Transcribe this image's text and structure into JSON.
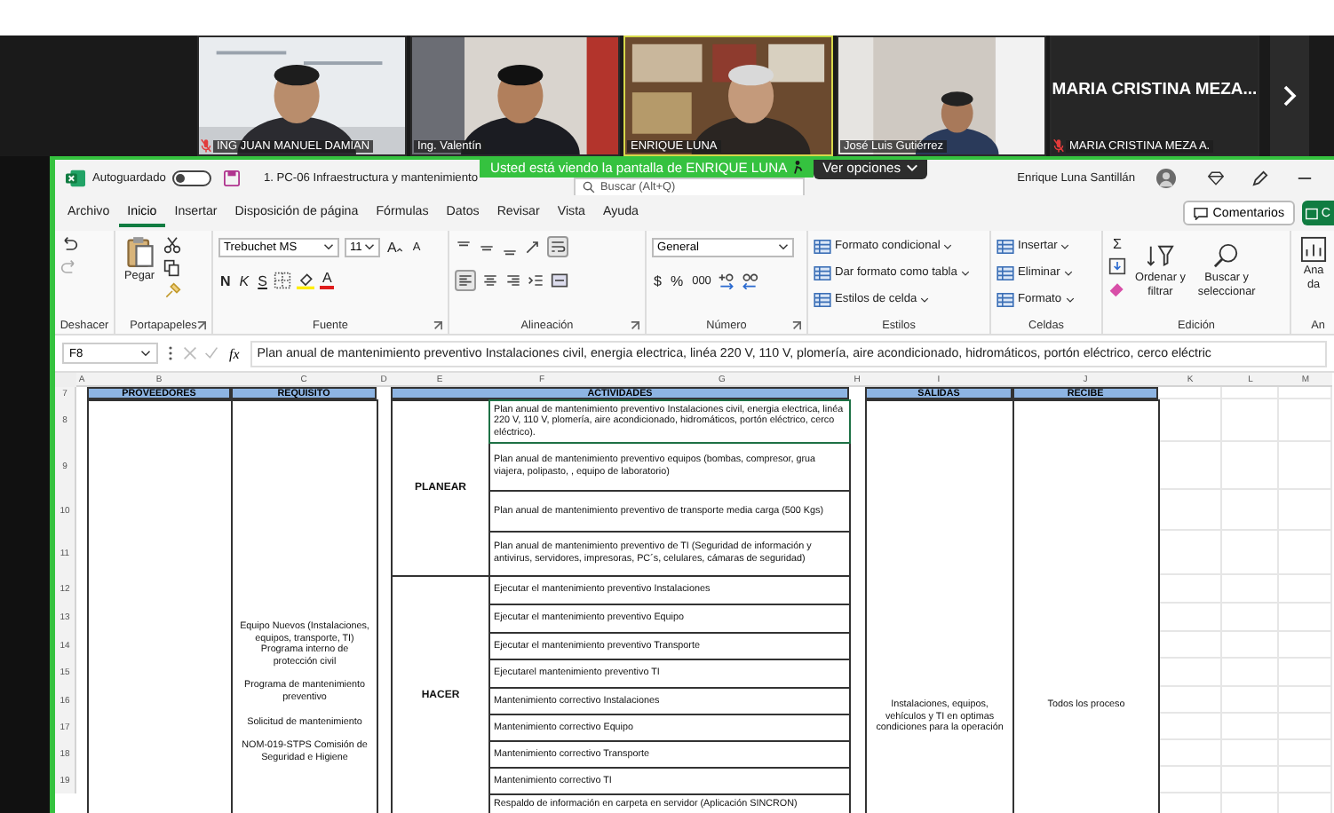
{
  "meeting": {
    "participants": [
      {
        "name": "ING JUAN MANUEL DAMIAN",
        "kind": "video",
        "muted": true,
        "speaking": false
      },
      {
        "name": "Ing. Valentín",
        "kind": "video",
        "muted": false,
        "speaking": false
      },
      {
        "name": "ENRIQUE LUNA",
        "kind": "video",
        "muted": false,
        "speaking": true
      },
      {
        "name": "José Luis Gutiérrez",
        "kind": "video",
        "muted": false,
        "speaking": false
      },
      {
        "name": "MARIA CRISTINA MEZA A.",
        "display_name": "MARIA CRISTINA MEZA...",
        "kind": "avatar",
        "muted": true,
        "speaking": false
      }
    ],
    "share_banner": "Usted está viendo la pantalla de ENRIQUE LUNA",
    "view_options": "Ver opciones"
  },
  "excel": {
    "autosave_label": "Autoguardado",
    "autosave_on": false,
    "file_title": "1. PC-06 Infraestructura y mantenimiento",
    "search_placeholder": "Buscar (Alt+Q)",
    "user_name": "Enrique Luna Santillán",
    "menu": [
      {
        "label": "Archivo",
        "selected": false
      },
      {
        "label": "Inicio",
        "selected": true
      },
      {
        "label": "Insertar",
        "selected": false
      },
      {
        "label": "Disposición de página",
        "selected": false
      },
      {
        "label": "Fórmulas",
        "selected": false
      },
      {
        "label": "Datos",
        "selected": false
      },
      {
        "label": "Revisar",
        "selected": false
      },
      {
        "label": "Vista",
        "selected": false
      },
      {
        "label": "Ayuda",
        "selected": false
      }
    ],
    "comments_button": "Comentarios",
    "share_button": "C",
    "ribbon": [
      {
        "kind": "undo",
        "label": "Deshacer",
        "launcher": false
      },
      {
        "kind": "clipboard",
        "label": "Portapapeles",
        "paste": "Pegar",
        "launcher": true
      },
      {
        "kind": "font",
        "label": "Fuente",
        "font": "Trebuchet MS",
        "size": "11",
        "grow": "A",
        "shrink": "A",
        "styles": [
          "N",
          "K",
          "S"
        ],
        "font_color": "A",
        "launcher": true
      },
      {
        "kind": "alignment",
        "label": "Alineación",
        "launcher": true
      },
      {
        "kind": "number",
        "label": "Número",
        "format": "General",
        "symbols": [
          "$",
          "%",
          "000"
        ],
        "launcher": true
      },
      {
        "kind": "list",
        "label": "Estilos",
        "items": [
          "Formato condicional",
          "Dar formato como tabla",
          "Estilos de celda"
        ],
        "launcher": false
      },
      {
        "kind": "list",
        "label": "Celdas",
        "items": [
          "Insertar",
          "Eliminar",
          "Formato"
        ],
        "launcher": false
      },
      {
        "kind": "editing",
        "label": "Edición",
        "sum": "Σ",
        "buttons": [
          [
            "Ordenar y",
            "filtrar"
          ],
          [
            "Buscar y",
            "seleccionar"
          ]
        ],
        "launcher": false
      },
      {
        "kind": "cut",
        "label": "An",
        "button": [
          "Ana",
          "da"
        ],
        "launcher": false
      }
    ],
    "name_box": "F8",
    "fx": "fx",
    "formula": "Plan anual de mantenimiento preventivo Instalaciones civil, energia electrica, linéa 220 V, 110 V, plomería, aire acondicionado, hidromáticos, portón eléctrico, cerco eléctric",
    "columns": [
      "A",
      "B",
      "C",
      "D",
      "E",
      "F",
      "G",
      "H",
      "I",
      "J",
      "K",
      "L",
      "M"
    ],
    "row_numbers": [
      "7",
      "8",
      "9",
      "10",
      "11",
      "12",
      "13",
      "14",
      "15",
      "16",
      "17",
      "18",
      "19"
    ],
    "headers": {
      "supplier": "PROVEEDORES",
      "requirement": "REQUISITO",
      "activities": "ACTIVIDADES",
      "outputs": "SALIDAS",
      "receiver": "RECIBE"
    },
    "requirements": [
      "Equipo Nuevos (Instalaciones, equipos, transporte, TI) Programa interno de protección civil",
      "Programa de mantenimiento preventivo",
      "Solicitud de mantenimiento",
      "NOM-019-STPS Comisión de Seguridad e Higiene"
    ],
    "phases": [
      {
        "label": "PLANEAR",
        "activities": [
          {
            "text": "Plan anual de mantenimiento preventivo Instalaciones civil, energia electrica, linéa 220 V, 110 V, plomería, aire acondicionado, hidromáticos, portón eléctrico, cerco eléctrico).",
            "selected": true
          },
          {
            "text": "Plan anual de mantenimiento preventivo equipos (bombas, compresor, grua viajera, polipasto, , equipo de laboratorio)",
            "selected": false
          },
          {
            "text": "Plan anual de mantenimiento preventivo de transporte media carga (500 Kgs)",
            "selected": false
          },
          {
            "text": "Plan anual de mantenimiento preventivo de TI (Seguridad de información y antivirus, servidores, impresoras, PC´s, celulares, cámaras de seguridad)",
            "selected": false
          }
        ]
      },
      {
        "label": "HACER",
        "activities": [
          {
            "text": "Ejecutar el mantenimiento preventivo Instalaciones",
            "selected": false
          },
          {
            "text": "Ejecutar el mantenimiento preventivo Equipo",
            "selected": false
          },
          {
            "text": "Ejecutar el mantenimiento preventivo Transporte",
            "selected": false
          },
          {
            "text": "Ejecutarel mantenimiento preventivo TI",
            "selected": false
          },
          {
            "text": "Mantenimiento correctivo Instalaciones",
            "selected": false
          },
          {
            "text": "Mantenimiento correctivo Equipo",
            "selected": false
          },
          {
            "text": "Mantenimiento correctivo Transporte",
            "selected": false
          },
          {
            "text": "Mantenimiento correctivo TI",
            "selected": false
          },
          {
            "text": "Respaldo de información en carpeta en servidor (Aplicación SINCRON)",
            "selected": false
          }
        ]
      }
    ],
    "outputs": "Instalaciones, equipos, vehículos y TI en optimas condiciones para la operación",
    "receiver": "Todos los proceso"
  }
}
